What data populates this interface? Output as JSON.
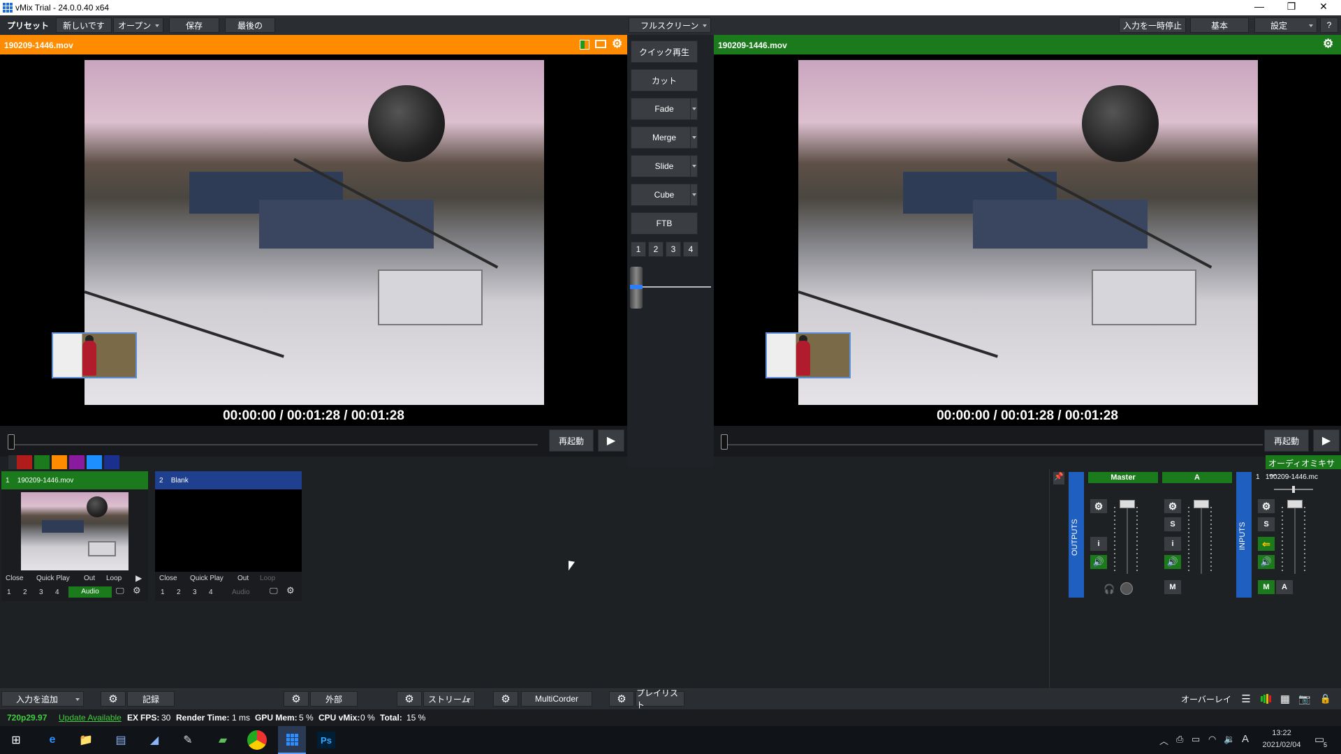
{
  "window": {
    "title": "vMix Trial - 24.0.0.40 x64"
  },
  "topbar": {
    "preset": "プリセット",
    "new": "新しいです",
    "open": "オープン",
    "save": "保存",
    "last": "最後の",
    "fullscreen": "フルスクリーン",
    "pause_input": "入力を一時停止",
    "basic": "基本",
    "settings": "設定",
    "help": "?"
  },
  "preview": {
    "title": "190209-1446.mov",
    "timecode": "00:00:00  /  00:01:28  /  00:01:28",
    "restart": "再起動",
    "accent": "#ff8c00"
  },
  "output": {
    "title": "190209-1446.mov",
    "timecode": "00:00:00  /  00:01:28  /  00:01:28",
    "restart": "再起動",
    "accent": "#1b7a1b"
  },
  "transitions": {
    "quick_play": "クイック再生",
    "cut": "カット",
    "fade": "Fade",
    "merge": "Merge",
    "slide": "Slide",
    "cube": "Cube",
    "ftb": "FTB",
    "numbers": [
      "1",
      "2",
      "3",
      "4"
    ]
  },
  "color_tags": [
    "#2a2d31",
    "#b01c1c",
    "#1b7a1b",
    "#ff8c00",
    "#8a1b9e",
    "#1e8fff",
    "#1b2f8f"
  ],
  "inputs": [
    {
      "number": "1",
      "name": "190209-1446.mov",
      "header_color": "#1b7a1b",
      "controls": [
        "Close",
        "Quick Play",
        "Out",
        "Loop"
      ],
      "numbers": [
        "1",
        "2",
        "3",
        "4"
      ],
      "audio": "Audio"
    },
    {
      "number": "2",
      "name": "Blank",
      "header_color": "#1f3f8f",
      "controls": [
        "Close",
        "Quick Play",
        "Out",
        "Loop"
      ],
      "numbers": [
        "1",
        "2",
        "3",
        "4"
      ],
      "audio": "Audio"
    }
  ],
  "audio_mixer": {
    "title": "オーディオミキサー",
    "outputs_label": "OUTPUTS",
    "inputs_label": "INPUTS",
    "master": "Master",
    "bus_a": "A",
    "input_name": "190209-1446.mc",
    "input_number": "1",
    "s": "S",
    "i": "i",
    "m": "M",
    "a": "A"
  },
  "bottombar": {
    "add_input": "入力を追加",
    "record": "記録",
    "external": "外部",
    "stream": "ストリーム",
    "multicorder": "MultiCorder",
    "playlist": "プレイリスト",
    "overlay": "オーバーレイ"
  },
  "status": {
    "format": "720p29.97",
    "update": "Update Available",
    "ex": "EX",
    "fps_label": "FPS:",
    "fps": "30",
    "render_label": "Render Time:",
    "render": "1 ms",
    "gpu_label": "GPU Mem:",
    "gpu": "5 %",
    "cpu_label": "CPU vMix:",
    "cpu": "0 %",
    "total_label": "Total:",
    "total": "15 %"
  },
  "taskbar": {
    "time": "13:22",
    "date": "2021/02/04",
    "ime": "A",
    "notifications": "5"
  }
}
